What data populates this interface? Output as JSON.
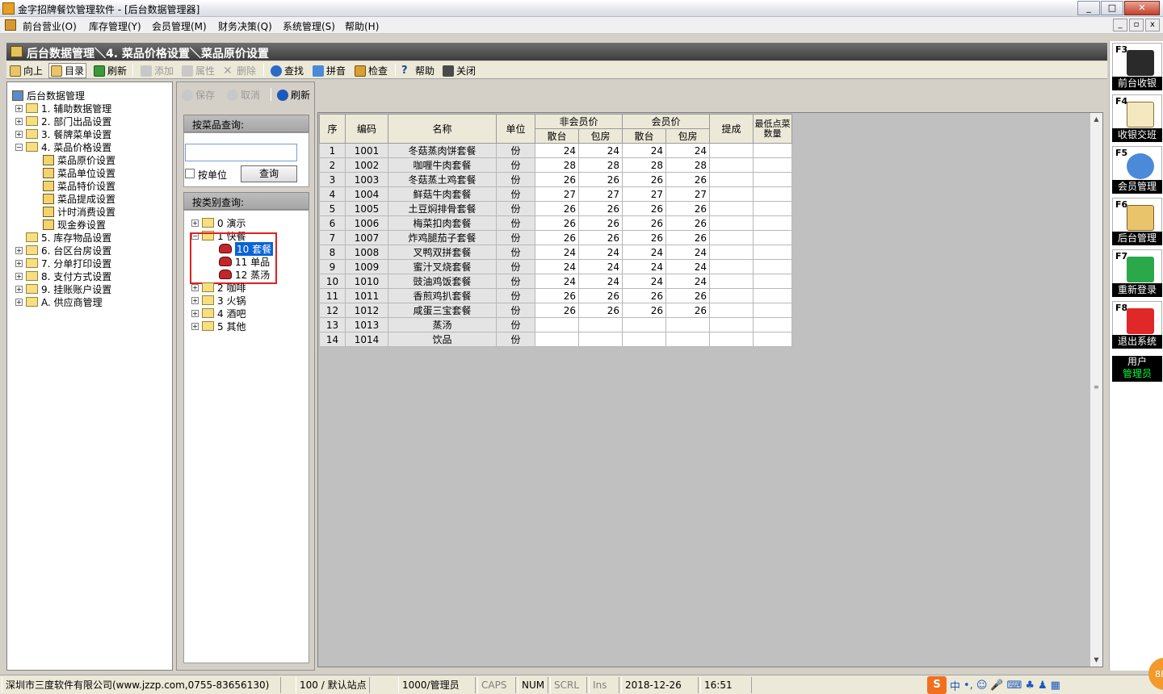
{
  "window": {
    "title": "金字招牌餐饮管理软件 - [后台数据管理器]",
    "min": "_",
    "max": "□",
    "close": "✕"
  },
  "menu": [
    "前台营业(O)",
    "库存管理(Y)",
    "会员管理(M)",
    "财务决策(Q)",
    "系统管理(S)",
    "帮助(H)"
  ],
  "mdi_buttons": {
    "min": "_",
    "restore": "▫",
    "close": "x"
  },
  "breadcrumb": "后台数据管理＼4. 菜品价格设置＼菜品原价设置",
  "toolbar": {
    "up": "向上",
    "dir": "目录",
    "refresh": "刷新",
    "add": "添加",
    "props": "属性",
    "del": "删除",
    "find": "查找",
    "pinyin": "拼音",
    "check": "检查",
    "help": "帮助",
    "close": "关闭"
  },
  "tree": {
    "root": "后台数据管理",
    "items": [
      "1. 辅助数据管理",
      "2. 部门出品设置",
      "3. 餐牌菜单设置",
      "4. 菜品价格设置"
    ],
    "sub": [
      "菜品原价设置",
      "菜品单位设置",
      "菜品特价设置",
      "菜品提成设置",
      "计时消费设置",
      "现金券设置"
    ],
    "rest": [
      "5. 库存物品设置",
      "6. 台区台房设置",
      "7. 分单打印设置",
      "8. 支付方式设置",
      "9. 挂账账户设置",
      "A. 供应商管理"
    ]
  },
  "mid": {
    "save": "保存",
    "cancel": "取消",
    "refresh": "刷新",
    "search_header": "按菜品查询:",
    "search_value": "",
    "by_unit": "按单位",
    "query": "查询",
    "cat_header": "按类别查询:",
    "cats": [
      "0 演示",
      "1 快餐",
      "2 咖啡",
      "3 火锅",
      "4 酒吧",
      "5 其他"
    ],
    "subcats": [
      "10 套餐",
      "11 单品",
      "12 蒸汤"
    ]
  },
  "grid": {
    "headers": {
      "seq": "序",
      "code": "编码",
      "name": "名称",
      "unit": "单位",
      "nonmember": "非会员价",
      "member": "会员价",
      "hall": "散台",
      "room": "包房",
      "commission": "提成",
      "minimum": "最低点菜数量"
    },
    "rows": [
      [
        "1",
        "1001",
        "冬菇蒸肉饼套餐",
        "份",
        "24",
        "24",
        "24",
        "24"
      ],
      [
        "2",
        "1002",
        "咖喱牛肉套餐",
        "份",
        "28",
        "28",
        "28",
        "28"
      ],
      [
        "3",
        "1003",
        "冬菇蒸土鸡套餐",
        "份",
        "26",
        "26",
        "26",
        "26"
      ],
      [
        "4",
        "1004",
        "鲜菇牛肉套餐",
        "份",
        "27",
        "27",
        "27",
        "27"
      ],
      [
        "5",
        "1005",
        "土豆焖排骨套餐",
        "份",
        "26",
        "26",
        "26",
        "26"
      ],
      [
        "6",
        "1006",
        "梅菜扣肉套餐",
        "份",
        "26",
        "26",
        "26",
        "26"
      ],
      [
        "7",
        "1007",
        "炸鸡腿茄子套餐",
        "份",
        "26",
        "26",
        "26",
        "26"
      ],
      [
        "8",
        "1008",
        "叉鸭双拼套餐",
        "份",
        "24",
        "24",
        "24",
        "24"
      ],
      [
        "9",
        "1009",
        "蜜汁叉烧套餐",
        "份",
        "24",
        "24",
        "24",
        "24"
      ],
      [
        "10",
        "1010",
        "豉油鸡饭套餐",
        "份",
        "24",
        "24",
        "24",
        "24"
      ],
      [
        "11",
        "1011",
        "香煎鸡扒套餐",
        "份",
        "26",
        "26",
        "26",
        "26"
      ],
      [
        "12",
        "1012",
        "咸蛋三宝套餐",
        "份",
        "26",
        "26",
        "26",
        "26"
      ],
      [
        "13",
        "1013",
        "蒸汤",
        "份",
        "",
        "",
        "",
        ""
      ],
      [
        "14",
        "1014",
        "饮品",
        "份",
        "",
        "",
        "",
        ""
      ]
    ]
  },
  "right": [
    {
      "key": "F3",
      "label": "前台收银"
    },
    {
      "key": "F4",
      "label": "收银交班"
    },
    {
      "key": "F5",
      "label": "会员管理"
    },
    {
      "key": "F6",
      "label": "后台管理"
    },
    {
      "key": "F7",
      "label": "重新登录"
    },
    {
      "key": "F8",
      "label": "退出系统"
    }
  ],
  "user": {
    "label": "用户",
    "name": "管理员"
  },
  "status": {
    "company": "深圳市三度软件有限公司(www.jzzp.com,0755-83656130)",
    "station": "100 / 默认站点",
    "operator": "1000/管理员",
    "caps": "CAPS",
    "num": "NUM",
    "scrl": "SCRL",
    "ins": "Ins",
    "date": "2018-12-26",
    "time": "16:51"
  },
  "ime": {
    "logo": "S",
    "lang": "中",
    "punct": "•,",
    "badge": "88"
  },
  "colors": {
    "highlight": "#e02020",
    "selection": "#0a64d8",
    "userName": "#00ff40"
  }
}
